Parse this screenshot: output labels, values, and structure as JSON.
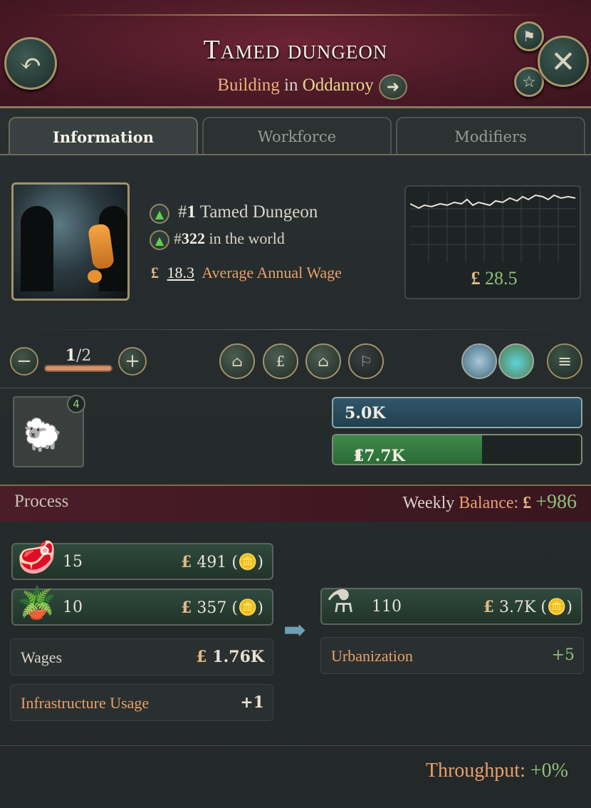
{
  "header": {
    "title": "Tamed dungeon",
    "subtitle_building": "Building",
    "subtitle_in": "in",
    "subtitle_location": "Oddanroy"
  },
  "tabs": [
    {
      "label": "Information",
      "active": true
    },
    {
      "label": "Workforce",
      "active": false
    },
    {
      "label": "Modifiers",
      "active": false
    }
  ],
  "info": {
    "rank_local_prefix": "#",
    "rank_local_number": "1",
    "rank_local_label": "Tamed Dungeon",
    "rank_world_prefix": "#",
    "rank_world_number": "322",
    "rank_world_label": "in the world",
    "currency": "£",
    "avg_wage_value": "18.3",
    "avg_wage_label": "Average Annual Wage",
    "graph_value": "28.5"
  },
  "level": {
    "current": "1",
    "separator": "/",
    "max": "2"
  },
  "ownership": {
    "owner_count": "4",
    "cash_reserve": "5.0K",
    "cash_total": "17.7K",
    "cash_fill_fraction": 0.6
  },
  "process": {
    "title": "Process",
    "balance_weekly": "Weekly",
    "balance_label": "Balance:",
    "balance_value": "+986",
    "inputs": [
      {
        "icon": "meat-icon",
        "qty": "15",
        "price": "491 (",
        "suffix": ")"
      },
      {
        "icon": "plant-icon",
        "qty": "10",
        "price": "357 (",
        "suffix": ")"
      }
    ],
    "outputs": [
      {
        "icon": "potion-icon",
        "qty": "110",
        "price": "3.7K (",
        "suffix": ")"
      }
    ],
    "wages_label": "Wages",
    "wages_value": "1.76K",
    "infra_label": "Infrastructure Usage",
    "infra_value": "+1",
    "urban_label": "Urbanization",
    "urban_value": "+5",
    "throughput_label": "Throughput:",
    "throughput_value": "+0%"
  },
  "colors": {
    "header_bg": "#4e1a27",
    "positive": "#8ec07a",
    "label_orange": "#e9a06a"
  }
}
